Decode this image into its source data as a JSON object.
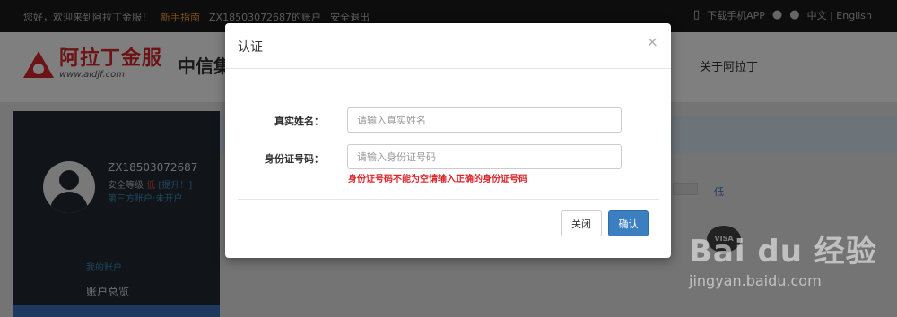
{
  "topbar": {
    "greeting": "您好，欢迎来到阿拉丁金服！",
    "guide": "新手指南",
    "account": "ZX18503072687的账户",
    "logout": "安全退出",
    "download_app": "下载手机APP",
    "language": "中文 | English"
  },
  "header": {
    "logo_cn": "阿拉丁金服",
    "logo_en": "www.aldjf.com",
    "logo_partner": "中信集",
    "nav_about": "关于阿拉丁"
  },
  "sidebar": {
    "user_id": "ZX18503072687",
    "security_label": "安全等级",
    "security_level": "低",
    "security_upgrade": "[提升！]",
    "third_party": "第三方账户:未开户",
    "my_account": "我的账户",
    "account_overview": "账户总览"
  },
  "main": {
    "level_text": "低",
    "card_label": "VISA"
  },
  "modal": {
    "title": "认证",
    "close_symbol": "×",
    "name_label": "真实姓名：",
    "name_placeholder": "请输入真实姓名",
    "id_label": "身份证号码：",
    "id_placeholder": "请输入身份证号码",
    "error": "身份证号码不能为空请输入正确的身份证号码",
    "close_button": "关闭",
    "ok_button": "确认"
  },
  "watermark": {
    "big": "Bai du 经验",
    "small": "jingyan.baidu.com"
  },
  "colors": {
    "accent_red": "#d9262c",
    "primary_blue": "#3c7fc1",
    "guide_orange": "#f39c3d"
  }
}
